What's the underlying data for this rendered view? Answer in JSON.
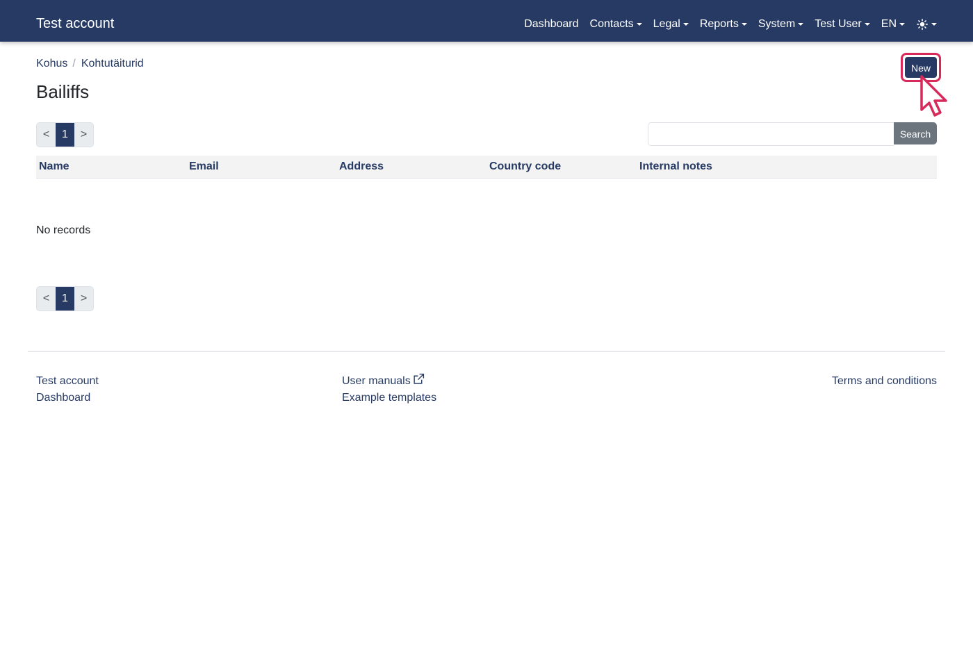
{
  "navbar": {
    "brand": "Test account",
    "items": [
      {
        "label": "Dashboard",
        "dropdown": false
      },
      {
        "label": "Contacts",
        "dropdown": true
      },
      {
        "label": "Legal",
        "dropdown": true
      },
      {
        "label": "Reports",
        "dropdown": true
      },
      {
        "label": "System",
        "dropdown": true
      },
      {
        "label": "Test User",
        "dropdown": true
      },
      {
        "label": "EN",
        "dropdown": true
      }
    ],
    "theme_icon": "sun-icon"
  },
  "breadcrumb": {
    "items": [
      "Kohus",
      "Kohtutäiturid"
    ],
    "separator": "/"
  },
  "page": {
    "title": "Bailiffs",
    "new_button": "New"
  },
  "pagination": {
    "prev": "<",
    "current": "1",
    "next": ">"
  },
  "search": {
    "placeholder": "",
    "value": "",
    "button": "Search"
  },
  "table": {
    "columns": [
      "Name",
      "Email",
      "Address",
      "Country code",
      "Internal notes"
    ],
    "rows": [],
    "empty_text": "No records"
  },
  "footer": {
    "col1": [
      "Test account",
      "Dashboard"
    ],
    "col2": [
      "User manuals",
      "Example templates"
    ],
    "col3": [
      "Terms and conditions"
    ]
  },
  "colors": {
    "primary": "#263a64",
    "highlight": "#d72a5b",
    "secondary": "#6c757d"
  }
}
